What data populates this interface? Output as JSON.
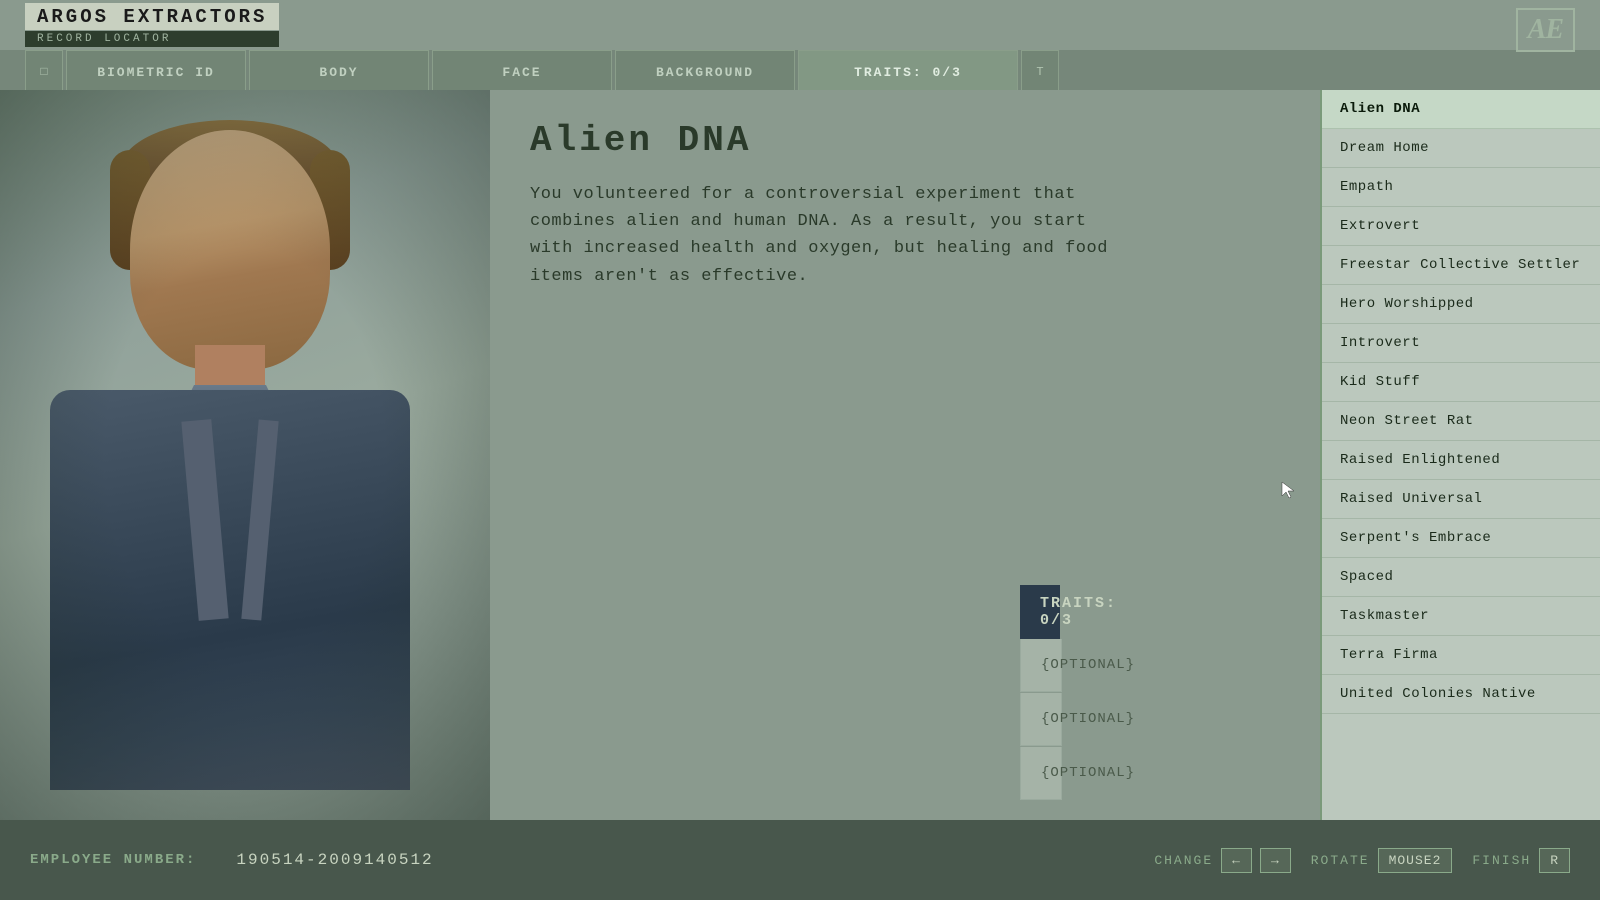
{
  "header": {
    "company_name": "ARGOS EXTRACTORS",
    "subtitle": "RECORD LOCATOR",
    "logo": "AE"
  },
  "nav": {
    "square_left": "□",
    "biometric_id": "BIOMETRIC ID",
    "body": "BODY",
    "face": "FACE",
    "background": "BACKGROUND",
    "traits": "TRAITS: 0/3",
    "square_right": "T"
  },
  "trait": {
    "title": "Alien DNA",
    "description": "You volunteered for a controversial experiment that combines alien and human DNA. As a result, you start with increased health and oxygen, but healing and food items aren't as effective."
  },
  "traits_panel": {
    "header": "TRAITS: 0/3",
    "slot1": "{OPTIONAL}",
    "slot2": "{OPTIONAL}",
    "slot3": "{OPTIONAL}"
  },
  "trait_list": {
    "items": [
      {
        "id": "alien-dna",
        "label": "Alien DNA",
        "active": true
      },
      {
        "id": "dream-home",
        "label": "Dream Home",
        "active": false
      },
      {
        "id": "empath",
        "label": "Empath",
        "active": false
      },
      {
        "id": "extrovert",
        "label": "Extrovert",
        "active": false
      },
      {
        "id": "freestar",
        "label": "Freestar Collective Settler",
        "active": false
      },
      {
        "id": "hero-worshipped",
        "label": "Hero Worshipped",
        "active": false
      },
      {
        "id": "introvert",
        "label": "Introvert",
        "active": false
      },
      {
        "id": "kid-stuff",
        "label": "Kid Stuff",
        "active": false
      },
      {
        "id": "neon-street-rat",
        "label": "Neon Street Rat",
        "active": false
      },
      {
        "id": "raised-enlightened",
        "label": "Raised Enlightened",
        "active": false
      },
      {
        "id": "raised-universal",
        "label": "Raised Universal",
        "active": false
      },
      {
        "id": "serpents-embrace",
        "label": "Serpent's Embrace",
        "active": false
      },
      {
        "id": "spaced",
        "label": "Spaced",
        "active": false
      },
      {
        "id": "taskmaster",
        "label": "Taskmaster",
        "active": false
      },
      {
        "id": "terra-firma",
        "label": "Terra Firma",
        "active": false
      },
      {
        "id": "united-colonies-native",
        "label": "United Colonies Native",
        "active": false
      }
    ]
  },
  "status_bar": {
    "employee_label": "EMPLOYEE NUMBER:",
    "employee_number": "190514-2009140512",
    "change_label": "CHANGE",
    "change_key_left": "←",
    "change_key_right": "→",
    "rotate_label": "ROTATE",
    "rotate_key": "MOUSE2",
    "finish_label": "FINISH",
    "finish_key": "R"
  },
  "colors": {
    "accent_green": "#8aaa8a",
    "dark_panel": "#2a3a2a",
    "bg_main": "#8a9a8e",
    "text_dark": "#1a2a1a",
    "text_light": "#c8d4c0",
    "active_item_bg": "#d8e4d4",
    "traits_header_bg": "#2a3a4a"
  }
}
